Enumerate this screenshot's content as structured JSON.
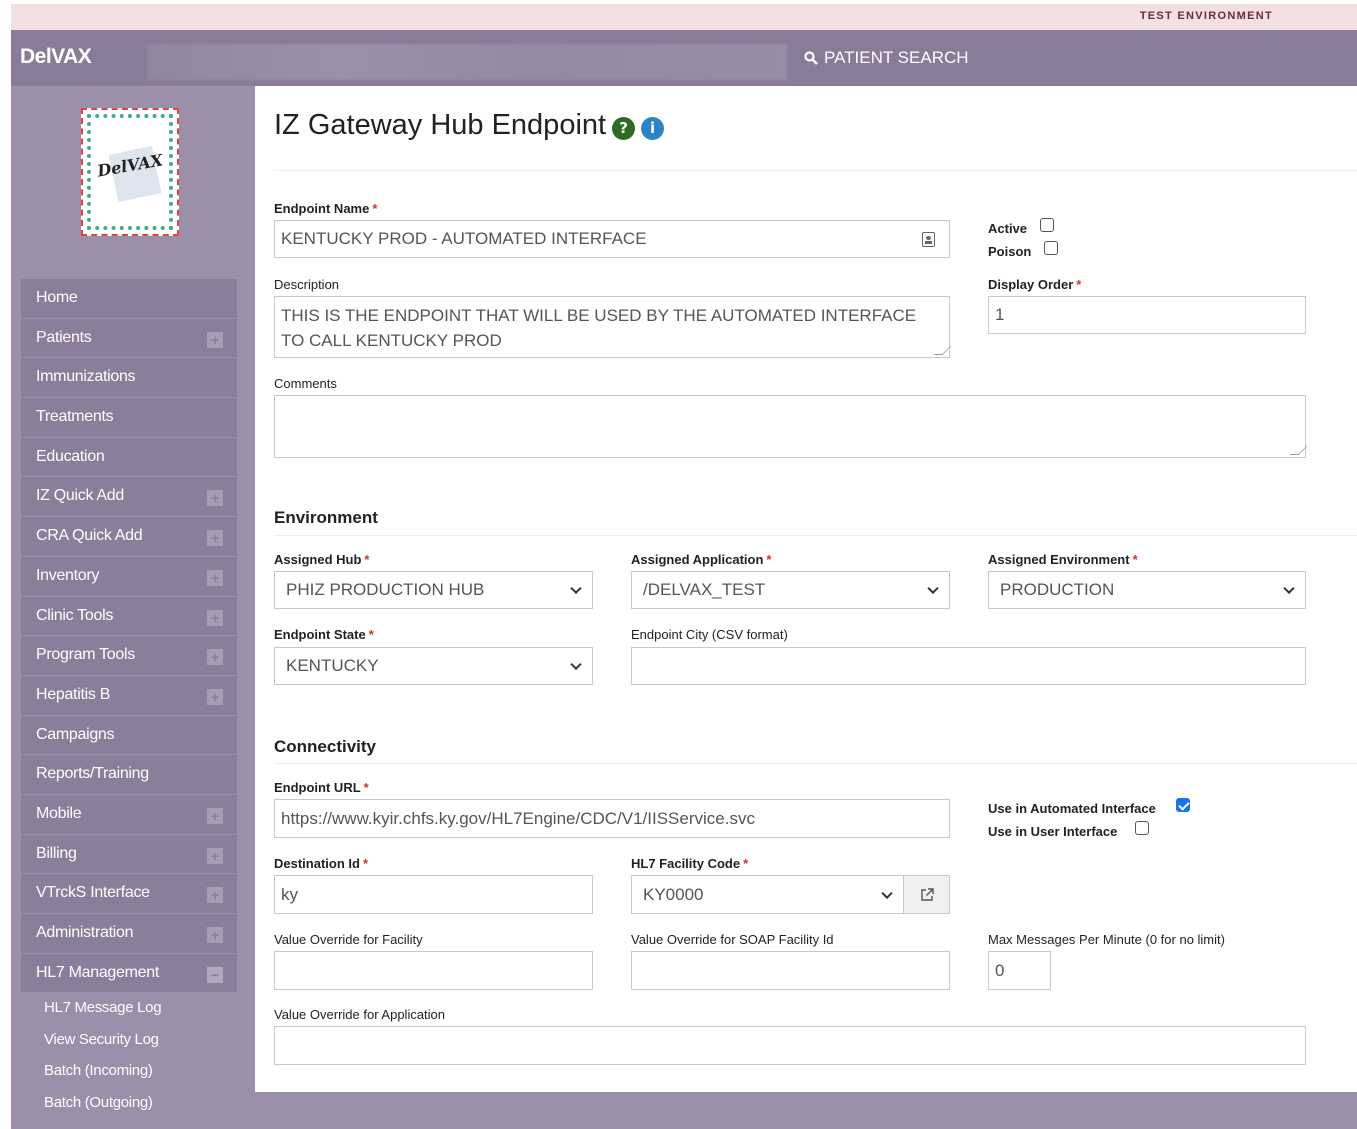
{
  "banner": {
    "text": "TEST ENVIRONMENT"
  },
  "topbar": {
    "brand": "DelVAX",
    "patient_search": "PATIENT SEARCH",
    "search_icon": "magnifier-icon"
  },
  "logo": {
    "text": "DelVAX"
  },
  "sidebar": {
    "items": [
      {
        "label": "Home",
        "expandable": false
      },
      {
        "label": "Patients",
        "expandable": true
      },
      {
        "label": "Immunizations",
        "expandable": false
      },
      {
        "label": "Treatments",
        "expandable": false
      },
      {
        "label": "Education",
        "expandable": false
      },
      {
        "label": "IZ Quick Add",
        "expandable": true
      },
      {
        "label": "CRA Quick Add",
        "expandable": true
      },
      {
        "label": "Inventory",
        "expandable": true
      },
      {
        "label": "Clinic Tools",
        "expandable": true
      },
      {
        "label": "Program Tools",
        "expandable": true
      },
      {
        "label": "Hepatitis B",
        "expandable": true
      },
      {
        "label": "Campaigns",
        "expandable": false
      },
      {
        "label": "Reports/Training",
        "expandable": false
      },
      {
        "label": "Mobile",
        "expandable": true
      },
      {
        "label": "Billing",
        "expandable": true
      },
      {
        "label": "VTrckS Interface",
        "expandable": true
      },
      {
        "label": "Administration",
        "expandable": true
      },
      {
        "label": "HL7 Management",
        "expandable": true,
        "open": true
      }
    ],
    "subitems": [
      "HL7 Message Log",
      "View Security Log",
      "Batch (Incoming)",
      "Batch (Outgoing)"
    ]
  },
  "page": {
    "title": "IZ Gateway Hub Endpoint",
    "help_icon": "question-circle-icon",
    "info_icon": "info-circle-icon"
  },
  "form": {
    "endpoint_name": {
      "label": "Endpoint Name",
      "value": "KENTUCKY PROD - AUTOMATED INTERFACE"
    },
    "active": {
      "label": "Active",
      "checked": false
    },
    "poison": {
      "label": "Poison",
      "checked": false
    },
    "description": {
      "label": "Description",
      "value": "THIS IS THE ENDPOINT THAT WILL BE USED BY THE AUTOMATED INTERFACE TO CALL KENTUCKY PROD"
    },
    "display_order": {
      "label": "Display Order",
      "value": "1"
    },
    "comments": {
      "label": "Comments",
      "value": ""
    },
    "environment_section": "Environment",
    "assigned_hub": {
      "label": "Assigned Hub",
      "value": "PHIZ PRODUCTION HUB"
    },
    "assigned_application": {
      "label": "Assigned Application",
      "value": "/DELVAX_TEST"
    },
    "assigned_environment": {
      "label": "Assigned Environment",
      "value": "PRODUCTION"
    },
    "endpoint_state": {
      "label": "Endpoint State",
      "value": "KENTUCKY"
    },
    "endpoint_city": {
      "label": "Endpoint City (CSV format)",
      "value": ""
    },
    "connectivity_section": "Connectivity",
    "endpoint_url": {
      "label": "Endpoint URL",
      "value": "https://www.kyir.chfs.ky.gov/HL7Engine/CDC/V1/IISService.svc"
    },
    "use_automated": {
      "label": "Use in Automated Interface",
      "checked": true
    },
    "use_user": {
      "label": "Use in User Interface",
      "checked": false
    },
    "destination_id": {
      "label": "Destination Id",
      "value": "ky"
    },
    "hl7_facility_code": {
      "label": "HL7 Facility Code",
      "value": "KY0000"
    },
    "override_facility": {
      "label": "Value Override for Facility",
      "value": ""
    },
    "override_soap_facility": {
      "label": "Value Override for SOAP Facility Id",
      "value": ""
    },
    "max_messages": {
      "label": "Max Messages Per Minute (0 for no limit)",
      "value": "0"
    },
    "override_application": {
      "label": "Value Override for Application",
      "value": ""
    }
  }
}
